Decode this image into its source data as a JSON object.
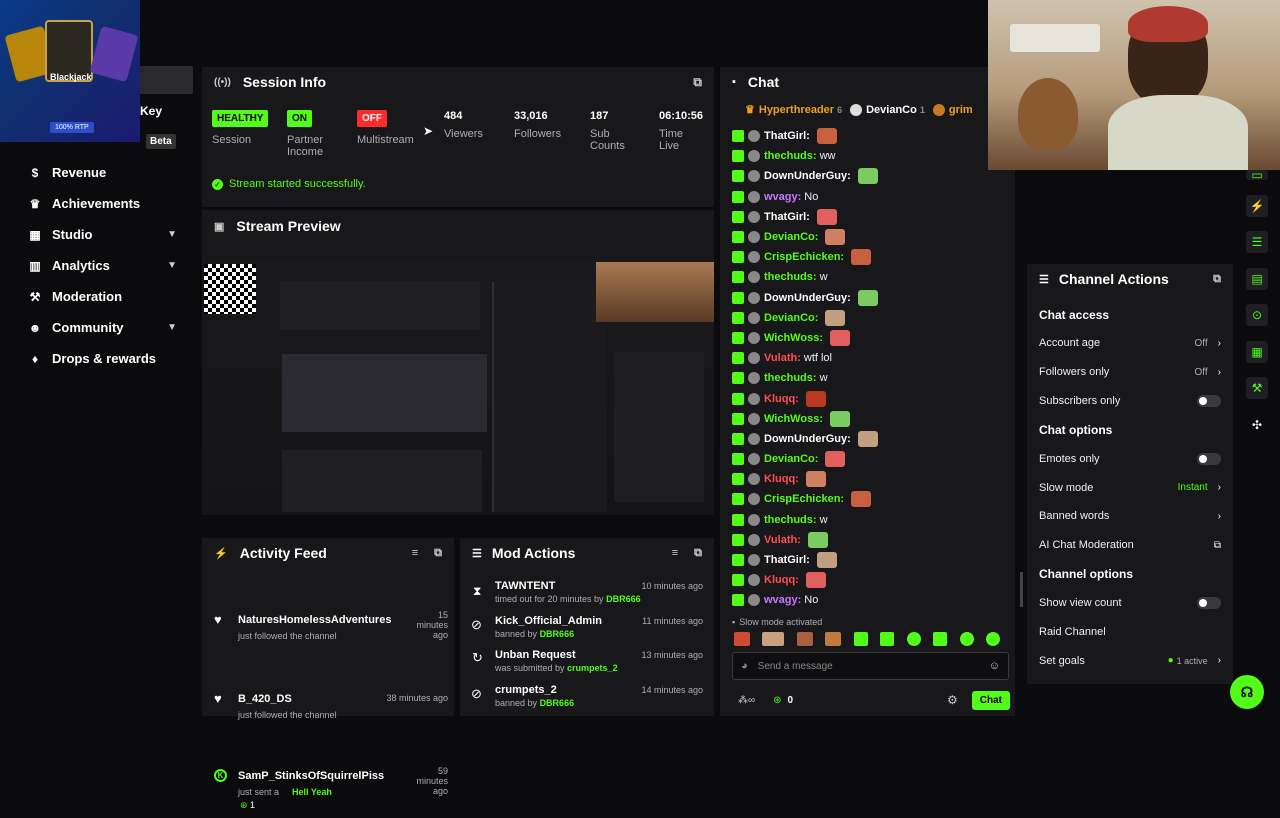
{
  "promo": {
    "title": "Blackjack",
    "badge": "100% RTP"
  },
  "sidebar": {
    "key_label": "Key",
    "beta_label": "Beta",
    "items": [
      {
        "label": "Revenue",
        "icon": "dollar-icon"
      },
      {
        "label": "Achievements",
        "icon": "trophy-icon"
      },
      {
        "label": "Studio",
        "icon": "studio-icon",
        "chev": "▼"
      },
      {
        "label": "Analytics",
        "icon": "chart-icon",
        "chev": "▼"
      },
      {
        "label": "Moderation",
        "icon": "wrench-icon"
      },
      {
        "label": "Community",
        "icon": "users-icon",
        "chev": "▼"
      },
      {
        "label": "Drops & rewards",
        "icon": "gift-icon"
      }
    ]
  },
  "session": {
    "title": "Session Info",
    "stats": [
      {
        "badge": "HEALTHY",
        "label": "Session"
      },
      {
        "badge": "ON",
        "label": "Partner Income"
      },
      {
        "badge": "OFF",
        "label": "Multistream"
      },
      {
        "value": "484",
        "label": "Viewers"
      },
      {
        "value": "33,016",
        "label": "Followers"
      },
      {
        "value": "187",
        "label": "Sub Counts"
      },
      {
        "value": "06:10:56",
        "label": "Time Live"
      }
    ],
    "status": "Stream started successfully."
  },
  "preview": {
    "title": "Stream Preview"
  },
  "activity": {
    "title": "Activity Feed",
    "items": [
      {
        "user": "NaturesHomelessAdventures",
        "action": "just followed the channel",
        "time": "15 minutes ago"
      },
      {
        "user": "B_420_DS",
        "action": "just followed the channel",
        "time": "38 minutes ago"
      },
      {
        "user": "SamP_StinksOfSquirrelPiss",
        "action": "just sent a",
        "extra": "Hell Yeah",
        "count": "1",
        "time": "59 minutes ago"
      }
    ]
  },
  "mod": {
    "title": "Mod Actions",
    "items": [
      {
        "user": "TAWNTENT",
        "action": "timed out for 20 minutes by",
        "by": "DBR666",
        "time": "10 minutes ago"
      },
      {
        "user": "Kick_Official_Admin",
        "action": "banned by",
        "by": "DBR666",
        "time": "11 minutes ago"
      },
      {
        "user": "Unban Request",
        "action": "was submitted by",
        "by": "crumpets_2",
        "time": "13 minutes ago"
      },
      {
        "user": "crumpets_2",
        "action": "banned by",
        "by": "DBR666",
        "time": "14 minutes ago"
      }
    ]
  },
  "chat": {
    "title": "Chat",
    "pinned": [
      {
        "name": "Hyperthreader",
        "count": "6"
      },
      {
        "name": "DevianCo",
        "count": "1"
      },
      {
        "name": "grim"
      }
    ],
    "messages": [
      {
        "user": "ThatGirl:",
        "color": "#ffffff",
        "msg": ""
      },
      {
        "user": "thechuds:",
        "color": "#53fc18",
        "msg": "ww"
      },
      {
        "user": "DownUnderGuy:",
        "color": "#ffffff",
        "msg": ""
      },
      {
        "user": "wvagy:",
        "color": "#c678ff",
        "msg": "No"
      },
      {
        "user": "ThatGirl:",
        "color": "#ffffff",
        "msg": ""
      },
      {
        "user": "DevianCo:",
        "color": "#53fc18",
        "msg": ""
      },
      {
        "user": "CrispEchicken:",
        "color": "#53fc18",
        "msg": ""
      },
      {
        "user": "thechuds:",
        "color": "#53fc18",
        "msg": "w"
      },
      {
        "user": "DownUnderGuy:",
        "color": "#ffffff",
        "msg": ""
      },
      {
        "user": "DevianCo:",
        "color": "#53fc18",
        "msg": ""
      },
      {
        "user": "WichWoss:",
        "color": "#53fc18",
        "msg": ""
      },
      {
        "user": "Vulath:",
        "color": "#ff4d4d",
        "msg": "wtf lol"
      },
      {
        "user": "thechuds:",
        "color": "#53fc18",
        "msg": "w"
      },
      {
        "user": "Kluqq:",
        "color": "#ff4d4d",
        "msg": ""
      },
      {
        "user": "WichWoss:",
        "color": "#53fc18",
        "msg": ""
      },
      {
        "user": "DownUnderGuy:",
        "color": "#ffffff",
        "msg": ""
      },
      {
        "user": "DevianCo:",
        "color": "#53fc18",
        "msg": ""
      },
      {
        "user": "Kluqq:",
        "color": "#ff4d4d",
        "msg": ""
      },
      {
        "user": "CrispEchicken:",
        "color": "#53fc18",
        "msg": ""
      },
      {
        "user": "thechuds:",
        "color": "#53fc18",
        "msg": "w"
      },
      {
        "user": "Vulath:",
        "color": "#ff4d4d",
        "msg": ""
      },
      {
        "user": "ThatGirl:",
        "color": "#ffffff",
        "msg": ""
      },
      {
        "user": "Kluqq:",
        "color": "#ff4d4d",
        "msg": ""
      },
      {
        "user": "wvagy:",
        "color": "#c678ff",
        "msg": "No"
      }
    ],
    "slow_mode_notice": "Slow mode activated",
    "input_placeholder": "Send a message",
    "points": "0",
    "send_label": "Chat"
  },
  "channel_actions": {
    "title": "Channel Actions",
    "chat_access": "Chat access",
    "account_age": {
      "label": "Account age",
      "value": "Off"
    },
    "followers_only": {
      "label": "Followers only",
      "value": "Off"
    },
    "subscribers_only": "Subscribers only",
    "chat_options": "Chat options",
    "emotes_only": "Emotes only",
    "slow_mode": {
      "label": "Slow mode",
      "value": "Instant"
    },
    "banned_words": "Banned words",
    "ai_moderation": "AI Chat Moderation",
    "channel_options": "Channel options",
    "show_view_count": "Show view count",
    "raid_channel": "Raid Channel",
    "set_goals": {
      "label": "Set goals",
      "value": "1 active"
    }
  },
  "colors": {
    "accent": "#53fc18",
    "bg": "#0b0b0d",
    "panel": "#18181b"
  }
}
